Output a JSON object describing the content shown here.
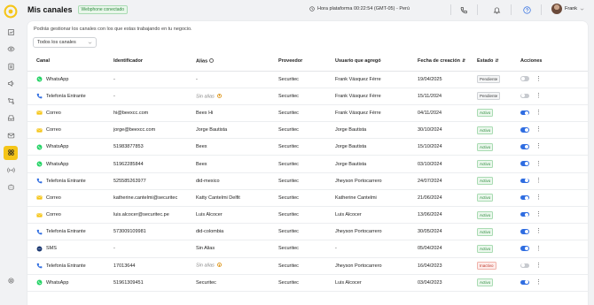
{
  "header": {
    "title": "Mis canales",
    "connection_badge": "Webphone conectado",
    "clock_text": "Hora plataforma 00:22:54 (GMT-05) - Perú",
    "user_name": "Frank"
  },
  "sidebar": {
    "items": [
      {
        "icon": "chart-icon"
      },
      {
        "icon": "eye-icon"
      },
      {
        "icon": "contacts-icon"
      },
      {
        "icon": "megaphone-icon"
      },
      {
        "icon": "flow-icon"
      },
      {
        "icon": "inbox-icon"
      },
      {
        "icon": "mail-icon"
      },
      {
        "icon": "channels-icon",
        "active": true
      },
      {
        "icon": "broadcast-icon"
      },
      {
        "icon": "bot-icon"
      }
    ],
    "bottom_icon": "settings-icon"
  },
  "main": {
    "subtitle": "Podrás gestionar los canales con los que estas trabajando en tu negocio.",
    "filter": {
      "selected": "Todos los canales"
    },
    "columns": [
      "Canal",
      "Identificador",
      "Alias",
      "Proveedor",
      "Usuario que agregó",
      "Fecha de creación",
      "Estado",
      "Acciones"
    ],
    "rows": [
      {
        "canal": "WhatsApp",
        "type": "whatsapp",
        "identificador": "-",
        "alias": "-",
        "alias_muted": false,
        "alias_warn": false,
        "proveedor": "Securitec",
        "usuario": "Frank Vásquez Férre",
        "fecha": "19/04/2025",
        "estado": "Pendiente",
        "estado_kind": "pending",
        "enabled": false
      },
      {
        "canal": "Telefonía Entrante",
        "type": "phone",
        "identificador": "-",
        "alias": "Sin alias",
        "alias_muted": true,
        "alias_warn": true,
        "proveedor": "Securitec",
        "usuario": "Frank Vásquez Férre",
        "fecha": "15/11/2024",
        "estado": "Pendiente",
        "estado_kind": "pending",
        "enabled": false
      },
      {
        "canal": "Correo",
        "type": "mail",
        "identificador": "hi@beexcc.com",
        "alias": "Beex Hi",
        "alias_muted": false,
        "alias_warn": false,
        "proveedor": "Securitec",
        "usuario": "Frank Vásquez Férre",
        "fecha": "04/11/2024",
        "estado": "Activo",
        "estado_kind": "active",
        "enabled": true
      },
      {
        "canal": "Correo",
        "type": "mail",
        "identificador": "jorge@beexcc.com",
        "alias": "Jorge Bautista",
        "alias_muted": false,
        "alias_warn": false,
        "proveedor": "Securitec",
        "usuario": "Jorge Bautista",
        "fecha": "30/10/2024",
        "estado": "Activo",
        "estado_kind": "active",
        "enabled": true
      },
      {
        "canal": "WhatsApp",
        "type": "whatsapp",
        "identificador": "51983877853",
        "alias": "Beex",
        "alias_muted": false,
        "alias_warn": false,
        "proveedor": "Securitec",
        "usuario": "Jorge Bautista",
        "fecha": "15/10/2024",
        "estado": "Activo",
        "estado_kind": "active",
        "enabled": true
      },
      {
        "canal": "WhatsApp",
        "type": "whatsapp",
        "identificador": "51962285844",
        "alias": "Beex",
        "alias_muted": false,
        "alias_warn": false,
        "proveedor": "Securitec",
        "usuario": "Jorge Bautista",
        "fecha": "03/10/2024",
        "estado": "Activo",
        "estado_kind": "active",
        "enabled": true
      },
      {
        "canal": "Telefonía Entrante",
        "type": "phone",
        "identificador": "525585263977",
        "alias": "did-mexico",
        "alias_muted": false,
        "alias_warn": false,
        "proveedor": "Securitec",
        "usuario": "Jheyson Portocarrero",
        "fecha": "24/07/2024",
        "estado": "Activo",
        "estado_kind": "active",
        "enabled": true
      },
      {
        "canal": "Correo",
        "type": "mail",
        "identificador": "katherine.cantelmi@securitec",
        "alias": "Katty Cantelmi Delfit",
        "alias_muted": false,
        "alias_warn": false,
        "proveedor": "Securitec",
        "usuario": "Katherine Cantelmi",
        "fecha": "21/06/2024",
        "estado": "Activo",
        "estado_kind": "active",
        "enabled": true
      },
      {
        "canal": "Correo",
        "type": "mail",
        "identificador": "luis.alcocer@securitec.pe",
        "alias": "Luis Alcocer",
        "alias_muted": false,
        "alias_warn": false,
        "proveedor": "Securitec",
        "usuario": "Luis Alcocer",
        "fecha": "13/06/2024",
        "estado": "Activo",
        "estado_kind": "active",
        "enabled": true
      },
      {
        "canal": "Telefonía Entrante",
        "type": "phone",
        "identificador": "573009109981",
        "alias": "did-colombia",
        "alias_muted": false,
        "alias_warn": false,
        "proveedor": "Securitec",
        "usuario": "Jheyson Portocarrero",
        "fecha": "30/05/2024",
        "estado": "Activo",
        "estado_kind": "active",
        "enabled": true
      },
      {
        "canal": "SMS",
        "type": "sms",
        "identificador": "-",
        "alias": "Sin Alias",
        "alias_muted": false,
        "alias_warn": false,
        "proveedor": "Securitec",
        "usuario": "-",
        "fecha": "05/04/2024",
        "estado": "Activo",
        "estado_kind": "active",
        "enabled": true
      },
      {
        "canal": "Telefonía Entrante",
        "type": "phone",
        "identificador": "17013644",
        "alias": "Sin alias",
        "alias_muted": true,
        "alias_warn": true,
        "proveedor": "Securitec",
        "usuario": "Jheyson Portocarrero",
        "fecha": "16/04/2023",
        "estado": "Inactivo",
        "estado_kind": "inactive",
        "enabled": false
      },
      {
        "canal": "WhatsApp",
        "type": "whatsapp",
        "identificador": "51961309451",
        "alias": "Securitec",
        "alias_muted": false,
        "alias_warn": false,
        "proveedor": "Securitec",
        "usuario": "Luis Alcocer",
        "fecha": "03/04/2023",
        "estado": "Activo",
        "estado_kind": "active",
        "enabled": true
      }
    ]
  },
  "colors": {
    "accent": "#f5c518",
    "toggle_on": "#2f6de1",
    "whatsapp": "#25d366",
    "phone": "#2f6de1",
    "mail": "#f5c518",
    "sms": "#1f3b73"
  }
}
